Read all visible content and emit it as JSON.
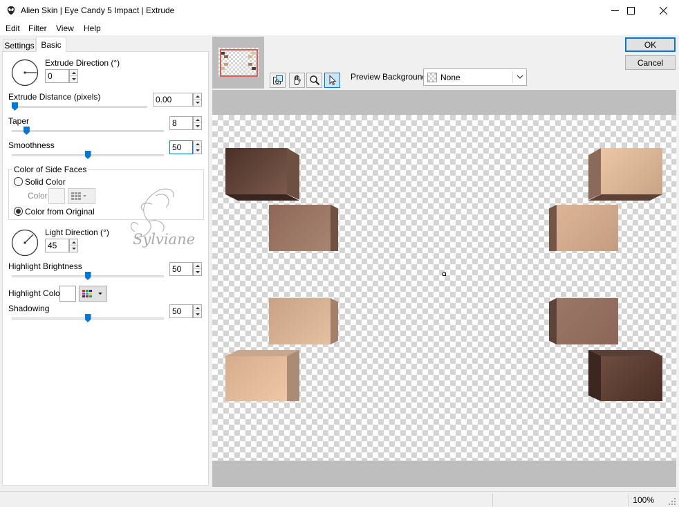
{
  "window": {
    "title": "Alien Skin | Eye Candy 5 Impact | Extrude"
  },
  "menu": [
    "Edit",
    "Filter",
    "View",
    "Help"
  ],
  "tabs": [
    "Settings",
    "Basic"
  ],
  "controls": {
    "extrude_direction": {
      "label": "Extrude Direction (°)",
      "value": "0",
      "angle_deg": 0
    },
    "extrude_distance": {
      "label": "Extrude Distance (pixels)",
      "value": "0.00",
      "slider": 0.0
    },
    "taper": {
      "label": "Taper",
      "value": "8",
      "slider": 0.08
    },
    "smoothness": {
      "label": "Smoothness",
      "value": "50",
      "slider": 0.5
    },
    "side_faces": {
      "group_label": "Color of Side Faces",
      "solid_label": "Solid Color",
      "color_label": "Color",
      "original_label": "Color from Original",
      "selected": "original"
    },
    "light_direction": {
      "label": "Light Direction (°)",
      "value": "45",
      "angle_deg": 45
    },
    "highlight_brightness": {
      "label": "Highlight Brightness",
      "value": "50",
      "slider": 0.5
    },
    "highlight_color": {
      "label": "Highlight Color",
      "color": "#ffffff"
    },
    "shadowing": {
      "label": "Shadowing",
      "value": "50",
      "slider": 0.5
    }
  },
  "watermark": "Sylviane",
  "preview": {
    "background_label": "Preview Background:",
    "background_value": "None",
    "zoom": "100%"
  },
  "buttons": {
    "ok": "OK",
    "cancel": "Cancel"
  },
  "icons": {
    "app": "alien-head-icon",
    "tools": [
      "navigator-icon",
      "hand-icon",
      "zoom-icon",
      "arrow-pointer-icon"
    ]
  },
  "colors": {
    "accent": "#0078d7",
    "dark_box": "#5a3c32",
    "light_box": "#e8c3a0"
  }
}
